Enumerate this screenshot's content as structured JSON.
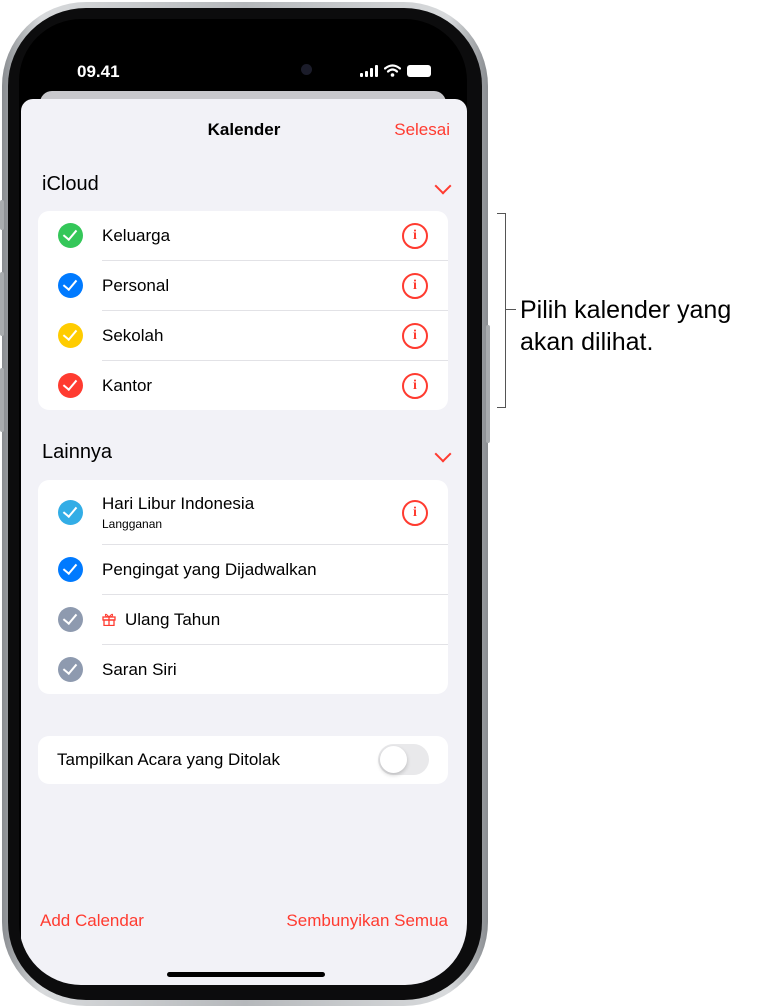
{
  "status": {
    "time": "09.41"
  },
  "nav": {
    "title": "Kalender",
    "done": "Selesai"
  },
  "sections": {
    "icloud": {
      "title": "iCloud",
      "items": [
        {
          "label": "Keluarga",
          "color": "#34c759"
        },
        {
          "label": "Personal",
          "color": "#007aff"
        },
        {
          "label": "Sekolah",
          "color": "#ffcc00"
        },
        {
          "label": "Kantor",
          "color": "#ff3b30"
        }
      ]
    },
    "other": {
      "title": "Lainnya",
      "items": [
        {
          "label": "Hari Libur Indonesia",
          "sublabel": "Langganan",
          "color": "#32ade6"
        },
        {
          "label": "Pengingat yang Dijadwalkan",
          "color": "#007aff"
        },
        {
          "label": "Ulang Tahun",
          "color": "#8e9aaf"
        },
        {
          "label": "Saran Siri",
          "color": "#8e9aaf"
        }
      ]
    }
  },
  "declined": {
    "label": "Tampilkan Acara yang Ditolak",
    "enabled": false
  },
  "footer": {
    "add": "Add Calendar",
    "hide_all": "Sembunyikan Semua"
  },
  "callout": {
    "line1": "Pilih kalender yang",
    "line2": "akan dilihat."
  },
  "colors": {
    "accent": "#ff3b30",
    "background": "#f2f2f7"
  },
  "icons": [
    "signal-icon",
    "wifi-icon",
    "battery-icon",
    "chevron-down-icon",
    "checkmark-icon",
    "info-icon",
    "gift-icon"
  ]
}
